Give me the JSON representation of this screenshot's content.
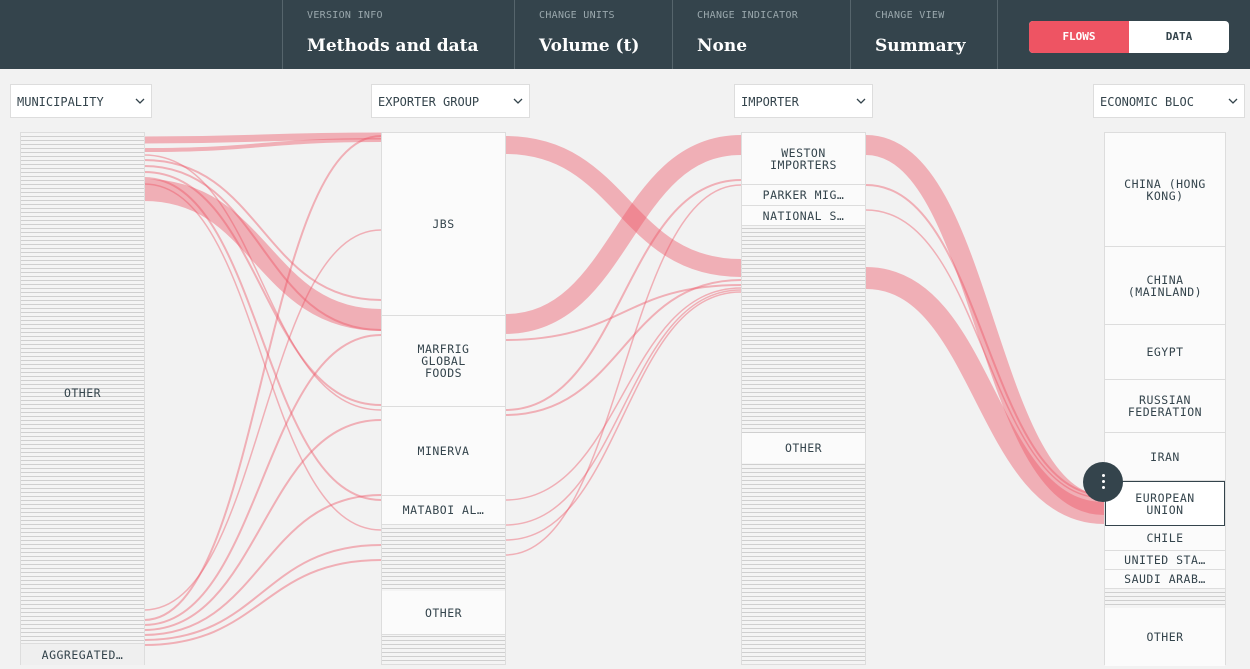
{
  "header": {
    "sections": [
      {
        "label": "VERSION INFO",
        "value": "Methods and data"
      },
      {
        "label": "CHANGE UNITS",
        "value": "Volume (t)"
      },
      {
        "label": "CHANGE INDICATOR",
        "value": "None"
      },
      {
        "label": "CHANGE VIEW",
        "value": "Summary"
      }
    ],
    "toggle": {
      "flows": "FLOWS",
      "data": "DATA"
    },
    "colors": {
      "bar": "#34444c",
      "accent": "#ee5463"
    }
  },
  "columns": [
    {
      "selector": "MUNICIPALITY",
      "nodes": [
        {
          "label": "OTHER"
        },
        {
          "label": "AGGREGATED…"
        }
      ]
    },
    {
      "selector": "EXPORTER GROUP",
      "nodes": [
        {
          "label": "JBS"
        },
        {
          "label": "MARFRIG\nGLOBAL\nFOODS"
        },
        {
          "label": "MINERVA"
        },
        {
          "label": "MATABOI AL…"
        },
        {
          "label": "OTHER"
        }
      ]
    },
    {
      "selector": "IMPORTER",
      "nodes": [
        {
          "label": "WESTON\nIMPORTERS"
        },
        {
          "label": "PARKER MIG…"
        },
        {
          "label": "NATIONAL S…"
        },
        {
          "label": "OTHER"
        }
      ]
    },
    {
      "selector": "ECONOMIC BLOC",
      "nodes": [
        {
          "label": "CHINA (HONG\nKONG)"
        },
        {
          "label": "CHINA\n(MAINLAND)"
        },
        {
          "label": "EGYPT"
        },
        {
          "label": "RUSSIAN\nFEDERATION"
        },
        {
          "label": "IRAN"
        },
        {
          "label": "EUROPEAN\nUNION"
        },
        {
          "label": "CHILE"
        },
        {
          "label": "UNITED STA…"
        },
        {
          "label": "SAUDI ARAB…"
        },
        {
          "label": "OTHER"
        }
      ]
    }
  ],
  "icons": {
    "chevron": "chevron-down-icon",
    "menu": "more-vertical-icon"
  },
  "flow_color": "#ee5463"
}
